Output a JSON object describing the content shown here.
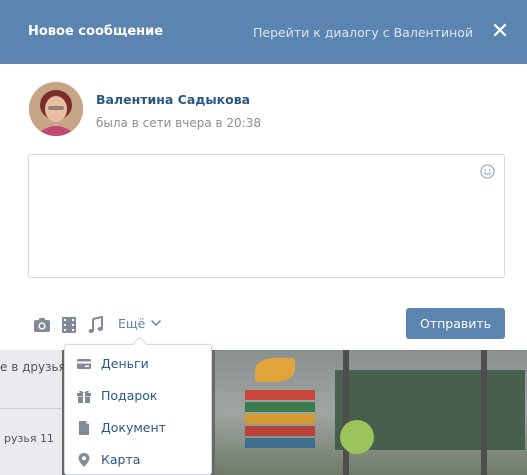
{
  "modal": {
    "title": "Новое сообщение",
    "goto_link": "Перейти к диалогу с Валентиной",
    "close_glyph": "✕"
  },
  "recipient": {
    "name": "Валентина Садыкова",
    "status": "была в сети вчера в 20:38"
  },
  "composer": {
    "message_text": "",
    "emoji_icon": "smile-icon"
  },
  "toolbar": {
    "attachments": [
      "camera-icon",
      "video-icon",
      "music-icon"
    ],
    "more_label": "Ещё",
    "send_label": "Отправить"
  },
  "more_menu": {
    "items": [
      {
        "label": "Деньги",
        "icon": "money-icon"
      },
      {
        "label": "Подарок",
        "icon": "gift-icon"
      },
      {
        "label": "Документ",
        "icon": "document-icon"
      },
      {
        "label": "Карта",
        "icon": "map-pin-icon"
      }
    ]
  },
  "background_page": {
    "snippet_1": "е в друзья",
    "snippet_2": "рузья 11"
  },
  "colors": {
    "header_bg": "#5b84b1",
    "link": "#2a5885",
    "button_bg": "#5b84b1",
    "icon_gray": "#828a99"
  }
}
